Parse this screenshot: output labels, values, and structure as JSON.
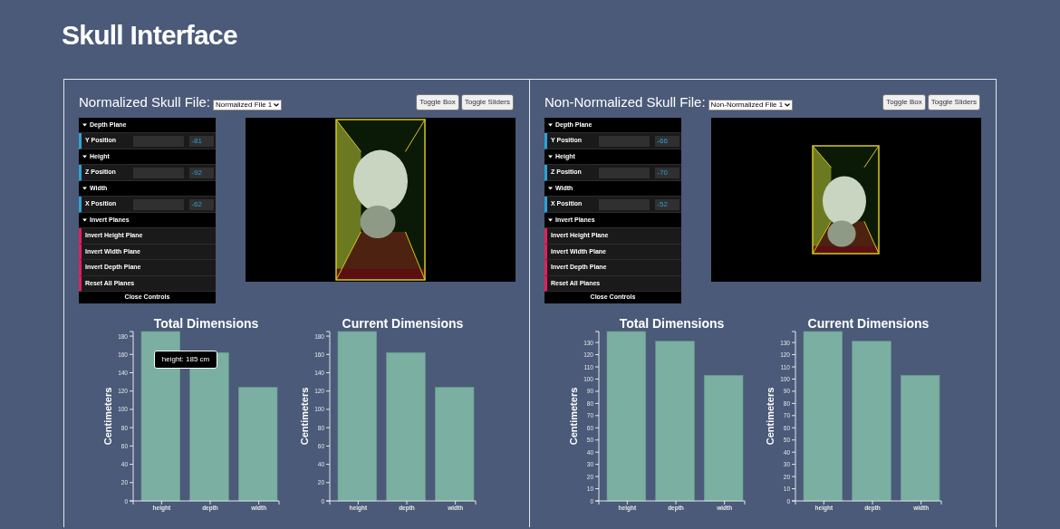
{
  "title": "Skull Interface",
  "panels": [
    {
      "label": "Normalized Skull File:",
      "file_select": "Normalized File 1",
      "buttons": [
        "Toggle Box",
        "Toggle Sliders"
      ],
      "controls": {
        "sections": [
          {
            "label": "Depth Plane",
            "expanded": true,
            "kind": "slider",
            "items": [
              {
                "label": "Y Position",
                "value": "-81"
              }
            ]
          },
          {
            "label": "Height",
            "expanded": true,
            "kind": "slider",
            "items": [
              {
                "label": "Z Position",
                "value": "-92"
              }
            ]
          },
          {
            "label": "Width",
            "expanded": true,
            "kind": "slider",
            "items": [
              {
                "label": "X Position",
                "value": "-62"
              }
            ]
          },
          {
            "label": "Invert Planes",
            "expanded": true,
            "kind": "button",
            "items": [
              {
                "label": "Invert Height Plane"
              },
              {
                "label": "Invert Width Plane"
              },
              {
                "label": "Invert Depth Plane"
              },
              {
                "label": "Reset All Planes"
              }
            ]
          }
        ],
        "close_label": "Close Controls"
      },
      "viewer": {
        "kind": "picture"
      },
      "charts": [
        {
          "chart_data": {
            "type": "bar",
            "title": "Total Dimensions",
            "ylabel": "Centimeters",
            "categories": [
              "height",
              "depth",
              "width"
            ],
            "values": [
              185,
              162,
              124
            ],
            "ylim": [
              0,
              185
            ],
            "yticks": [
              0,
              20,
              40,
              60,
              80,
              100,
              120,
              140,
              160,
              180
            ]
          },
          "tooltip": "height: 185 cm"
        },
        {
          "chart_data": {
            "type": "bar",
            "title": "Current Dimensions",
            "ylabel": "Centimeters",
            "categories": [
              "height",
              "depth",
              "width"
            ],
            "values": [
              185,
              162,
              124
            ],
            "ylim": [
              0,
              185
            ],
            "yticks": [
              0,
              20,
              40,
              60,
              80,
              100,
              120,
              140,
              160,
              180
            ]
          }
        }
      ]
    },
    {
      "label": "Non-Normalized Skull File:",
      "file_select": "Non-Normalized File 1",
      "buttons": [
        "Toggle Box",
        "Toggle Sliders"
      ],
      "controls": {
        "sections": [
          {
            "label": "Depth Plane",
            "expanded": true,
            "kind": "slider",
            "items": [
              {
                "label": "Y Position",
                "value": "-66"
              }
            ]
          },
          {
            "label": "Height",
            "expanded": true,
            "kind": "slider",
            "items": [
              {
                "label": "Z Position",
                "value": "-70"
              }
            ]
          },
          {
            "label": "Width",
            "expanded": true,
            "kind": "slider",
            "items": [
              {
                "label": "X Position",
                "value": "-52"
              }
            ]
          },
          {
            "label": "Invert Planes",
            "expanded": true,
            "kind": "button",
            "items": [
              {
                "label": "Invert Height Plane"
              },
              {
                "label": "Invert Width Plane"
              },
              {
                "label": "Invert Depth Plane"
              },
              {
                "label": "Reset All Planes"
              }
            ]
          }
        ],
        "close_label": "Close Controls"
      },
      "viewer": {
        "kind": "picture"
      },
      "charts": [
        {
          "chart_data": {
            "type": "bar",
            "title": "Total Dimensions",
            "ylabel": "Centimeters",
            "categories": [
              "height",
              "depth",
              "width"
            ],
            "values": [
              139,
              131,
              103
            ],
            "ylim": [
              0,
              139
            ],
            "yticks": [
              0,
              10,
              20,
              30,
              40,
              50,
              60,
              70,
              80,
              90,
              100,
              110,
              120,
              130
            ]
          }
        },
        {
          "chart_data": {
            "type": "bar",
            "title": "Current Dimensions",
            "ylabel": "Centimeters",
            "categories": [
              "height",
              "depth",
              "width"
            ],
            "values": [
              139,
              131,
              103
            ],
            "ylim": [
              0,
              139
            ],
            "yticks": [
              0,
              10,
              20,
              30,
              40,
              50,
              60,
              70,
              80,
              90,
              100,
              110,
              120,
              130
            ]
          }
        }
      ]
    }
  ]
}
